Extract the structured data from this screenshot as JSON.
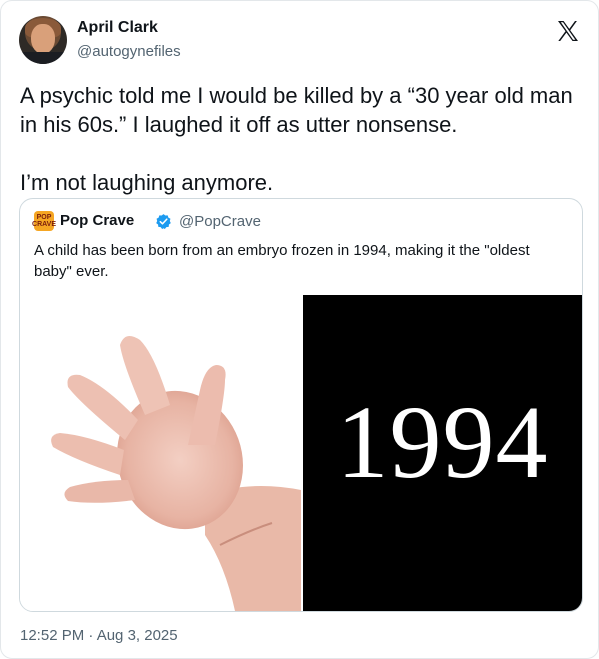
{
  "tweet": {
    "author_name": "April Clark",
    "author_handle": "@autogynefiles",
    "text": "A psychic told me I would be killed by a “30 year old man in his 60s.” I laughed it off as utter nonsense.\n\nI’m not laughing anymore.",
    "timestamp": "12:52 PM · Aug 3, 2025",
    "platform_icon": "x-logo-icon"
  },
  "quoted": {
    "author_name": "Pop Crave",
    "author_handle": "@PopCrave",
    "avatar_text": "POP CRAVE",
    "verified_icon": "verified-badge-icon",
    "text": "A child has been born from an embryo frozen in 1994, making it the \"oldest baby\" ever.",
    "image_left": "baby-hand-photo",
    "image_right_text": "1994"
  },
  "colors": {
    "text_primary": "#0f1419",
    "text_secondary": "#536471",
    "border": "#cfd9de",
    "verified": "#1d9bf0"
  }
}
